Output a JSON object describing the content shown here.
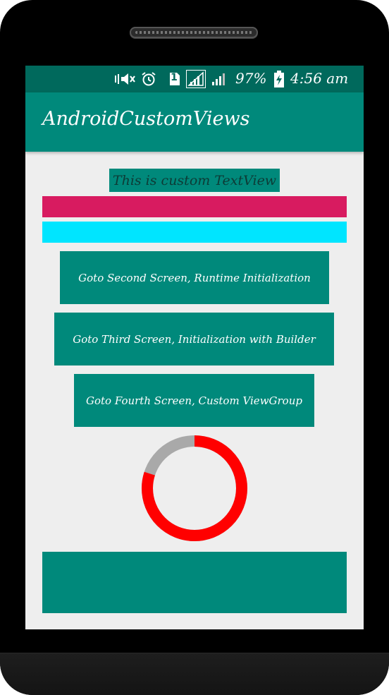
{
  "status_bar": {
    "sim_badge": "1",
    "battery_percent": "97%",
    "time": "4:56 am",
    "icons": [
      "mute-vibrate-icon",
      "alarm-icon",
      "sim-icon",
      "signal-icon",
      "signal-icon",
      "battery-charging-icon"
    ]
  },
  "app_bar": {
    "title": "AndroidCustomViews"
  },
  "main": {
    "custom_textview": "This is custom TextView",
    "bar_colors": [
      "#d81b60",
      "#00e5ff"
    ],
    "buttons": [
      {
        "label": "Goto Second Screen, Runtime Initialization"
      },
      {
        "label": "Goto Third Screen, Initialization with Builder"
      },
      {
        "label": "Goto Fourth Screen, Custom ViewGroup"
      }
    ],
    "progress_ring": {
      "value_fraction": 0.8,
      "progress_color": "#ff0000",
      "track_color": "#a9a9a9"
    },
    "accent_color": "#00897b"
  }
}
